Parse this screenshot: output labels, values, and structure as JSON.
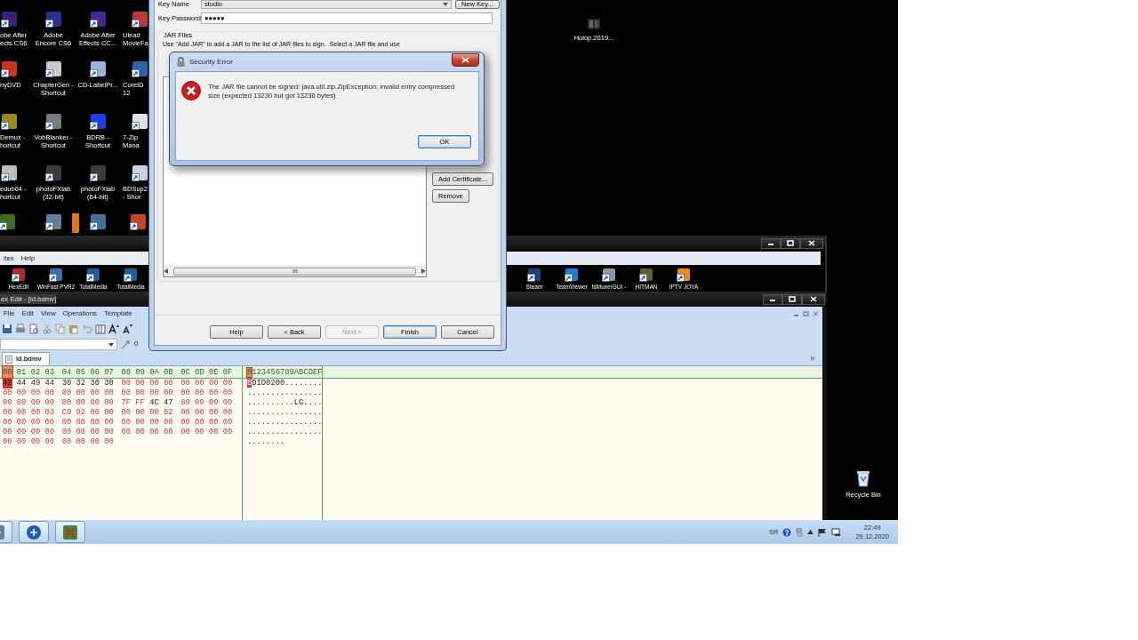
{
  "desktop_icons": [
    [
      {
        "kind": "shortcut",
        "lines": [
          "obe After",
          "ects CS6"
        ],
        "color": "#3b1f78"
      },
      {
        "kind": "shortcut",
        "lines": [
          "Adobe",
          "Encore CS6"
        ],
        "color": "#2a2f8c"
      },
      {
        "kind": "shortcut",
        "lines": [
          "Adobe After",
          "Effects CC..."
        ],
        "color": "#4a2590"
      },
      {
        "kind": "shortcut",
        "lines": [
          "Ulead",
          "MovieFa"
        ],
        "color": "#b83a3a"
      }
    ],
    [
      {
        "kind": "shortcut",
        "lines": [
          "nyDVD"
        ],
        "color": "#c8321e"
      },
      {
        "kind": "shortcut",
        "lines": [
          "ChapterGen -",
          "Shortcut"
        ],
        "color": "#c9c9c9"
      },
      {
        "kind": "shortcut",
        "lines": [
          "CD-LabelPr..."
        ],
        "color": "#9db4d6"
      },
      {
        "kind": "shortcut",
        "lines": [
          "CorelD",
          "12"
        ],
        "color": "#2f62a8"
      }
    ],
    [
      {
        "kind": "shortcut",
        "lines": [
          "Demux -",
          "hortcut"
        ],
        "color": "#9c8a1c"
      },
      {
        "kind": "shortcut",
        "lines": [
          "VobBlanker -",
          "Shortcut"
        ],
        "color": "#7a7a7a"
      },
      {
        "kind": "shortcut",
        "lines": [
          "BDRB -",
          "Shortcut"
        ],
        "color": "#1e3ee6"
      },
      {
        "kind": "shortcut",
        "lines": [
          "7-Zip",
          "Mana"
        ],
        "color": "#e2e2e2"
      }
    ],
    [
      {
        "kind": "shortcut",
        "lines": [
          "edub64 -",
          "hortcut"
        ],
        "color": "#bdbdbd"
      },
      {
        "kind": "shortcut",
        "lines": [
          "photoFXlab",
          "(32-bit)"
        ],
        "color": "#3c3c3c"
      },
      {
        "kind": "shortcut",
        "lines": [
          "photoFXlab",
          "(64-bit)"
        ],
        "color": "#3c3c3c"
      },
      {
        "kind": "shortcut",
        "lines": [
          "BDSup2",
          "- Shor"
        ],
        "color": "#ccd2e2"
      }
    ],
    [
      {
        "kind": "shortcut",
        "color": "#3d6b1f"
      },
      {
        "kind": "shortcut",
        "color": "#5f7f9f"
      },
      {
        "kind": "strip",
        "color": "#e07a10"
      },
      {
        "kind": "shortcut",
        "color": "#40729e"
      },
      {
        "kind": "shortcut",
        "color": "#c4462a"
      }
    ]
  ],
  "holop_icon": {
    "label": "Holop.2019..."
  },
  "recycle_bin": {
    "label": "Recycle Bin"
  },
  "back_window": {
    "menu": [
      "ites",
      "Help"
    ],
    "left_shortcuts": [
      {
        "label": "HexEdit",
        "color": "#b02a2a"
      },
      {
        "label": "WinFast PVR2",
        "color": "#3a6fa8"
      },
      {
        "label": "TotalMedia",
        "color": "#1f5ca0"
      },
      {
        "label": "TotalMedia",
        "color": "#1f5ca0"
      }
    ],
    "right_shortcuts": [
      {
        "label": "Steam",
        "color": "#1b3f78"
      },
      {
        "label": "TeamViewer",
        "color": "#1e7fd8"
      },
      {
        "label": "tsMuxerGUI -",
        "color": "#8a96a6"
      },
      {
        "label": "HITMAN",
        "color": "#6a5a30"
      },
      {
        "label": "IPTV JOYA",
        "color": "#f08a10"
      }
    ]
  },
  "hex_window": {
    "title": "ex Edit - [id.bdmv]",
    "menu": [
      "File",
      "Edit",
      "View",
      "Operations",
      "Template"
    ],
    "address_value": "0",
    "tabs": [
      {
        "label": "id.bdmv",
        "selected": true
      }
    ],
    "header": {
      "bytes": "00 01 02 03 04 05 06 07 08 09 0A 0B 0C 0D 0E 0F",
      "ascii": "0123456789ABCDEF",
      "marked": true
    },
    "rows": [
      {
        "bytes": "42 44 49 44 30 32 30 30 00 00 00 00 00 00 00 00",
        "ascii": "BDID0200........",
        "cursor": true,
        "dark": [
          true,
          true,
          true,
          true,
          true,
          true,
          true,
          true,
          false,
          false,
          false,
          false,
          false,
          false,
          false,
          false
        ]
      },
      {
        "bytes": "00 00 00 00 00 00 00 00 00 00 00 00 00 00 00 00",
        "ascii": "................",
        "cursor": false,
        "dark": [
          false,
          false,
          false,
          false,
          false,
          false,
          false,
          false,
          false,
          false,
          false,
          false,
          false,
          false,
          false,
          false
        ]
      },
      {
        "bytes": "00 00 00 00 00 00 00 00 7F FF 4C 47 80 00 00 00",
        "ascii": "..........LG....",
        "cursor": false,
        "dark": [
          false,
          false,
          false,
          false,
          false,
          false,
          false,
          false,
          false,
          false,
          true,
          true,
          false,
          false,
          false,
          false
        ]
      },
      {
        "bytes": "00 00 00 03 C9 92 00 00 00 00 00 02 00 00 00 00",
        "ascii": "................",
        "cursor": false,
        "dark": [
          false,
          false,
          false,
          false,
          false,
          false,
          false,
          false,
          false,
          false,
          false,
          false,
          false,
          false,
          false,
          false
        ]
      },
      {
        "bytes": "00 00 00 00 00 00 00 00 00 00 00 00 00 00 00 00",
        "ascii": "................",
        "cursor": false,
        "dark": [
          false,
          false,
          false,
          false,
          false,
          false,
          false,
          false,
          false,
          false,
          false,
          false,
          false,
          false,
          false,
          false
        ]
      },
      {
        "bytes": "00 00 00 00 00 00 00 00 00 00 00 00 00 00 00 00",
        "ascii": "................",
        "cursor": false,
        "dark": [
          false,
          false,
          false,
          false,
          false,
          false,
          false,
          false,
          false,
          false,
          false,
          false,
          false,
          false,
          false,
          false
        ]
      },
      {
        "bytes": "00 00 00 00 00 00 00 00",
        "ascii": "........",
        "cursor": false,
        "dark": [
          false,
          false,
          false,
          false,
          false,
          false,
          false,
          false
        ]
      }
    ]
  },
  "taskbar": {
    "buttons": [
      {
        "color": "#6a7f98"
      },
      {
        "color": "#1d5fa8"
      },
      {
        "color": "#3a8a3a"
      }
    ],
    "language": "SR",
    "time": "22:49",
    "date": "29.12.2020"
  },
  "wizard": {
    "key_name_label": "Key Name",
    "key_name_value": "studio",
    "new_key_button": "New Key...",
    "key_password_label": "Key Password",
    "key_password_value": "●●●●●",
    "group_title": "JAR Files",
    "description": "Use \"Add JAR\" to add a JAR to the list of JAR files to sign.  Select a JAR file and use",
    "side_buttons": [
      "Add Certificate...",
      "Remove"
    ],
    "buttons": [
      {
        "label": "Help",
        "disabled": false,
        "default": false
      },
      {
        "label": "< Back",
        "disabled": false,
        "default": false
      },
      {
        "label": "Next >",
        "disabled": true,
        "default": false
      },
      {
        "label": "Finish",
        "disabled": false,
        "default": true
      },
      {
        "label": "Cancel",
        "disabled": false,
        "default": false
      }
    ]
  },
  "error_dialog": {
    "title": "Security Error",
    "message": "The JAR file cannot be signed: java.util.zip.ZipException: invalid entry compressed size (expected 13230 but got 13236 bytes)",
    "button": "OK"
  }
}
